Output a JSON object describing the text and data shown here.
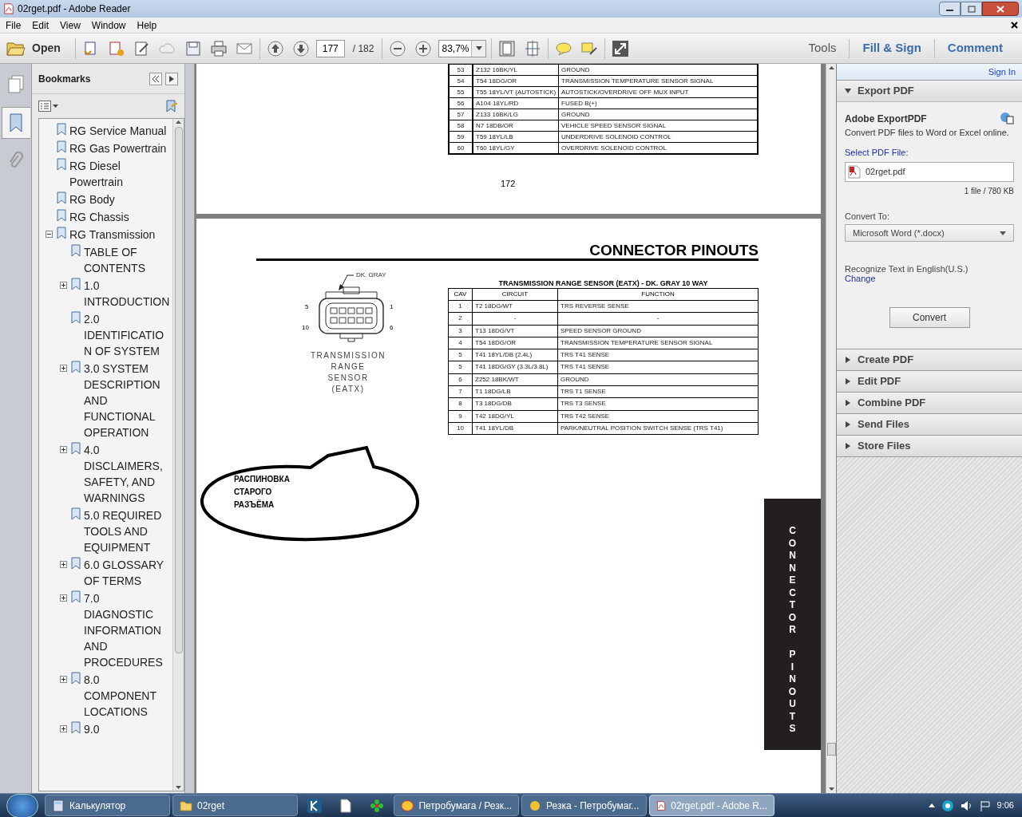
{
  "window": {
    "title": "02rget.pdf - Adobe Reader"
  },
  "menu": [
    "File",
    "Edit",
    "View",
    "Window",
    "Help"
  ],
  "toolbar": {
    "open": "Open",
    "page": "177",
    "page_total": "/ 182",
    "zoom": "83,7%",
    "links": [
      {
        "label": "Tools",
        "kind": "plain"
      },
      {
        "label": "Fill & Sign",
        "kind": "accent"
      },
      {
        "label": "Comment",
        "kind": "accent"
      }
    ]
  },
  "nav_panel": {
    "title": "Bookmarks",
    "tabs": [
      {
        "kind": "pages",
        "selected": false
      },
      {
        "kind": "bookmarks",
        "selected": true
      },
      {
        "kind": "attachments",
        "selected": false
      }
    ]
  },
  "bookmarks": [
    {
      "label": "RG Service Manual"
    },
    {
      "label": "RG Gas Powertrain"
    },
    {
      "label": "RG Diesel Powertrain"
    },
    {
      "label": "RG Body"
    },
    {
      "label": "RG Chassis"
    },
    {
      "label": "RG Transmission",
      "expanded": true,
      "children": [
        {
          "label": "TABLE OF CONTENTS"
        },
        {
          "label": "1.0 INTRODUCTION",
          "expanded": false
        },
        {
          "label": "2.0 IDENTIFICATION OF SYSTEM"
        },
        {
          "label": "3.0 SYSTEM DESCRIPTION AND FUNCTIONAL OPERATION",
          "expanded": false
        },
        {
          "label": "4.0 DISCLAIMERS, SAFETY, AND WARNINGS",
          "expanded": false
        },
        {
          "label": "5.0 REQUIRED TOOLS AND EQUIPMENT"
        },
        {
          "label": "6.0 GLOSSARY OF TERMS",
          "expanded": false
        },
        {
          "label": "7.0 DIAGNOSTIC INFORMATION AND PROCEDURES",
          "expanded": false
        },
        {
          "label": "8.0 COMPONENT LOCATIONS",
          "expanded": false
        },
        {
          "label": "9.0",
          "expanded": false
        }
      ]
    }
  ],
  "document": {
    "previous_page": {
      "rows": [
        [
          "53",
          "Z132 16BK/YL",
          "GROUND"
        ],
        [
          "54",
          "T54 18DG/OR",
          "TRANSMISSION TEMPERATURE SENSOR SIGNAL"
        ],
        [
          "55",
          "T55 18YL/VT (AUTOSTICK)",
          "AUTOSTICK/OVERDRIVE OFF MUX INPUT"
        ],
        [
          "56",
          "A104 18YL/RD",
          "FUSED B(+)"
        ],
        [
          "57",
          "Z133 16BK/LG",
          "GROUND"
        ],
        [
          "58",
          "N7 18DB/OR",
          "VEHICLE SPEED SENSOR SIGNAL"
        ],
        [
          "59",
          "T59 18YL/LB",
          "UNDERDRIVE SOLENOID CONTROL"
        ],
        [
          "60",
          "T60 18YL/GY",
          "OVERDRIVE SOLENOID CONTROL"
        ]
      ],
      "page_number": "172"
    },
    "page": {
      "heading": "CONNECTOR PINOUTS",
      "connector": {
        "callout": "DK. GRAY",
        "pin_labels": [
          "5",
          "1",
          "10",
          "6"
        ],
        "caption": [
          "TRANSMISSION",
          "RANGE",
          "SENSOR",
          "(EATX)"
        ]
      },
      "table": {
        "title": "TRANSMISSION RANGE SENSOR (EATX) - DK. GRAY 10 WAY",
        "columns": [
          "CAV",
          "CIRCUIT",
          "FUNCTION"
        ],
        "rows": [
          [
            "1",
            "T2 18DG/WT",
            "TRS REVERSE SENSE"
          ],
          [
            "2",
            "-",
            "-"
          ],
          [
            "3",
            "T13 18DG/VT",
            "SPEED SENSOR GROUND"
          ],
          [
            "4",
            "T54 18DG/OR",
            "TRANSMISSION TEMPERATURE SENSOR SIGNAL"
          ],
          [
            "5",
            "T41 18YL/DB (2.4L)",
            "TRS T41 SENSE"
          ],
          [
            "5",
            "T41 18DG/GY (3.3L/3.8L)",
            "TRS T41 SENSE"
          ],
          [
            "6",
            "Z252 18BK/WT",
            "GROUND"
          ],
          [
            "7",
            "T1 18DG/LB",
            "TRS T1 SENSE"
          ],
          [
            "8",
            "T3 18DG/DB",
            "TRS T3 SENSE"
          ],
          [
            "9",
            "T42 18DG/YL",
            "TRS T42 SENSE"
          ],
          [
            "10",
            "T41 18YL/DB",
            "PARK/NEUTRAL POSITION SWITCH SENSE (TRS T41)"
          ]
        ]
      },
      "note": [
        "РАСПИНОВКА",
        "СТАРОГО",
        "РАЗЪЁМА"
      ],
      "side_tab": "CONNECTOR PINOUTS"
    }
  },
  "tools_panel": {
    "sign_in": "Sign In",
    "sections": [
      {
        "title": "Export PDF",
        "expanded": true
      },
      {
        "title": "Create PDF",
        "expanded": false
      },
      {
        "title": "Edit PDF",
        "expanded": false
      },
      {
        "title": "Combine PDF",
        "expanded": false
      },
      {
        "title": "Send Files",
        "expanded": false
      },
      {
        "title": "Store Files",
        "expanded": false
      }
    ],
    "export": {
      "title": "Adobe ExportPDF",
      "description": "Convert PDF files to Word or Excel online.",
      "select_label": "Select PDF File:",
      "file": "02rget.pdf",
      "file_info": "1 file / 780 KB",
      "convert_label": "Convert To:",
      "format": "Microsoft Word (*.docx)",
      "recognize": "Recognize Text in English(U.S.)",
      "change": "Change",
      "button": "Convert"
    }
  },
  "taskbar": {
    "items": [
      {
        "kind": "calculator",
        "label": "Калькулятор",
        "selected": false
      },
      {
        "kind": "folder",
        "label": "02rget",
        "selected": false
      },
      {
        "kind": "app",
        "selected": false
      },
      {
        "kind": "document",
        "selected": false
      },
      {
        "kind": "flower",
        "selected": false
      },
      {
        "kind": "orange",
        "label": "Петробумага / Резк...",
        "selected": false
      },
      {
        "kind": "yellow",
        "label": "Резка - Петробумаг...",
        "selected": false
      },
      {
        "kind": "pdf",
        "label": "02rget.pdf - Adobe R...",
        "selected": true
      }
    ],
    "clock": "9:06"
  }
}
